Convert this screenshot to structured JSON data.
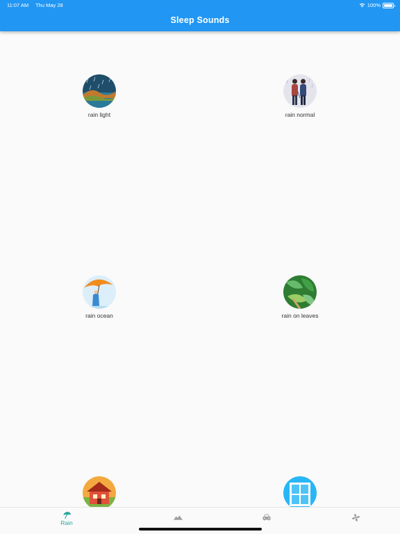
{
  "status_bar": {
    "time": "11:07 AM",
    "date": "Thu May 28",
    "battery": "100%"
  },
  "app_bar": {
    "title": "Sleep Sounds"
  },
  "sounds": [
    {
      "label": "rain light"
    },
    {
      "label": "rain normal"
    },
    {
      "label": "rain ocean"
    },
    {
      "label": "rain on leaves"
    },
    {
      "label": ""
    },
    {
      "label": ""
    }
  ],
  "bottom_nav": {
    "items": [
      {
        "label": "Rain",
        "icon": "umbrella-icon",
        "selected": true
      },
      {
        "label": "",
        "icon": "mountain-icon",
        "selected": false
      },
      {
        "label": "",
        "icon": "car-icon",
        "selected": false
      },
      {
        "label": "",
        "icon": "fan-icon",
        "selected": false
      }
    ]
  },
  "colors": {
    "app_bar": "#2196F3",
    "selected_nav": "#26a69a",
    "inactive_nav": "#9e9e9e"
  }
}
